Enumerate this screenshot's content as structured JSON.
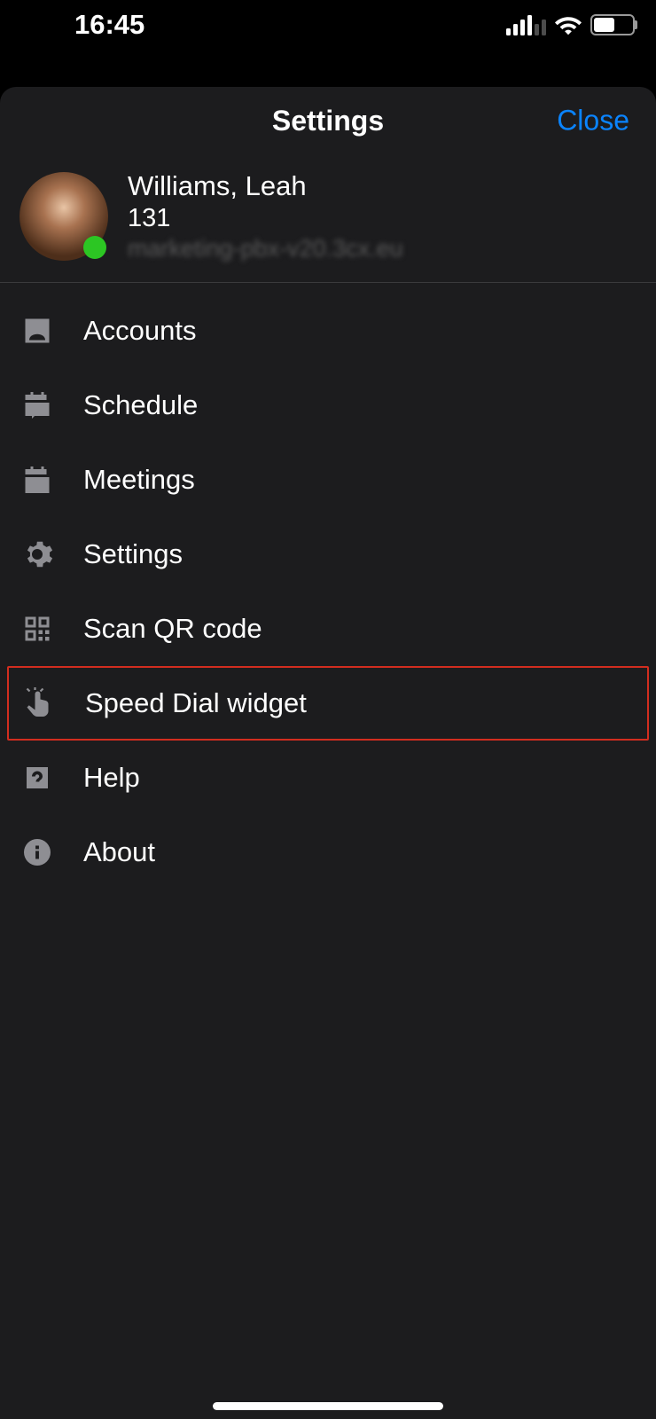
{
  "status": {
    "time": "16:45"
  },
  "header": {
    "title": "Settings",
    "close": "Close"
  },
  "profile": {
    "name": "Williams, Leah",
    "extension": "131",
    "server": "marketing-pbx-v20.3cx.eu"
  },
  "menu": {
    "accounts": "Accounts",
    "schedule": "Schedule",
    "meetings": "Meetings",
    "settings": "Settings",
    "scan_qr": "Scan QR code",
    "speed_dial": "Speed Dial widget",
    "help": "Help",
    "about": "About"
  }
}
